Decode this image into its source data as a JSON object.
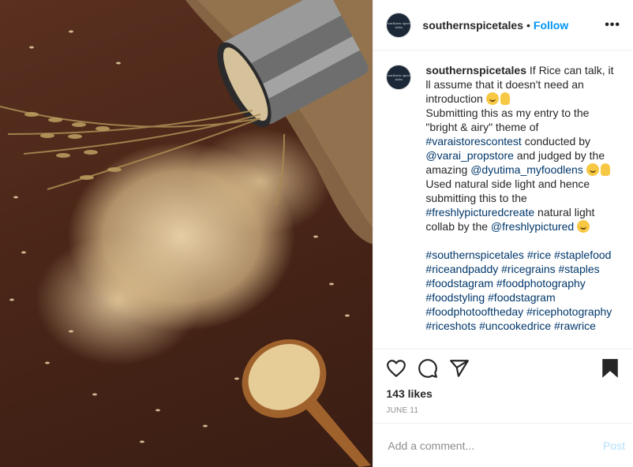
{
  "header": {
    "username": "southernspicetales",
    "separator": "•",
    "follow_label": "Follow",
    "more_label": "•••",
    "avatar_text": "southern spice tales"
  },
  "caption": {
    "username": "southernspicetales",
    "line1": " If Rice can talk, it ll assume that it doesn't need an introduction ",
    "line2a": "Submitting this as my entry to the \"bright & airy\" theme of ",
    "hashtag1": "#varaistorescontest",
    "line2b": " conducted by ",
    "mention1": "@varai_propstore",
    "line2c": " and judged by the amazing ",
    "mention2": "@dyutima_myfoodlens",
    "line3a": "Used natural side light and hence submitting this to the ",
    "hashtag2": "#freshlypicturedcreate",
    "line3b": " natural light collab by the ",
    "mention3": "@freshlypictured",
    "hashtags": "#southernspicetales #rice #staplefood #riceandpaddy #ricegrains #staples #foodstagram #foodphotography #foodstyling #foodstagram #foodphotooftheday #ricephotography #riceshots #uncookedrice #rawrice"
  },
  "actions": {
    "like_icon": "heart-icon",
    "comment_icon": "comment-icon",
    "share_icon": "share-icon",
    "save_icon": "bookmark-icon"
  },
  "likes": "143 likes",
  "date": "JUNE 11",
  "comment_box": {
    "placeholder": "Add a comment...",
    "post_label": "Post"
  },
  "colors": {
    "accent": "#0095f6",
    "hashtag": "#00376b",
    "post_disabled": "#b2dffc"
  }
}
